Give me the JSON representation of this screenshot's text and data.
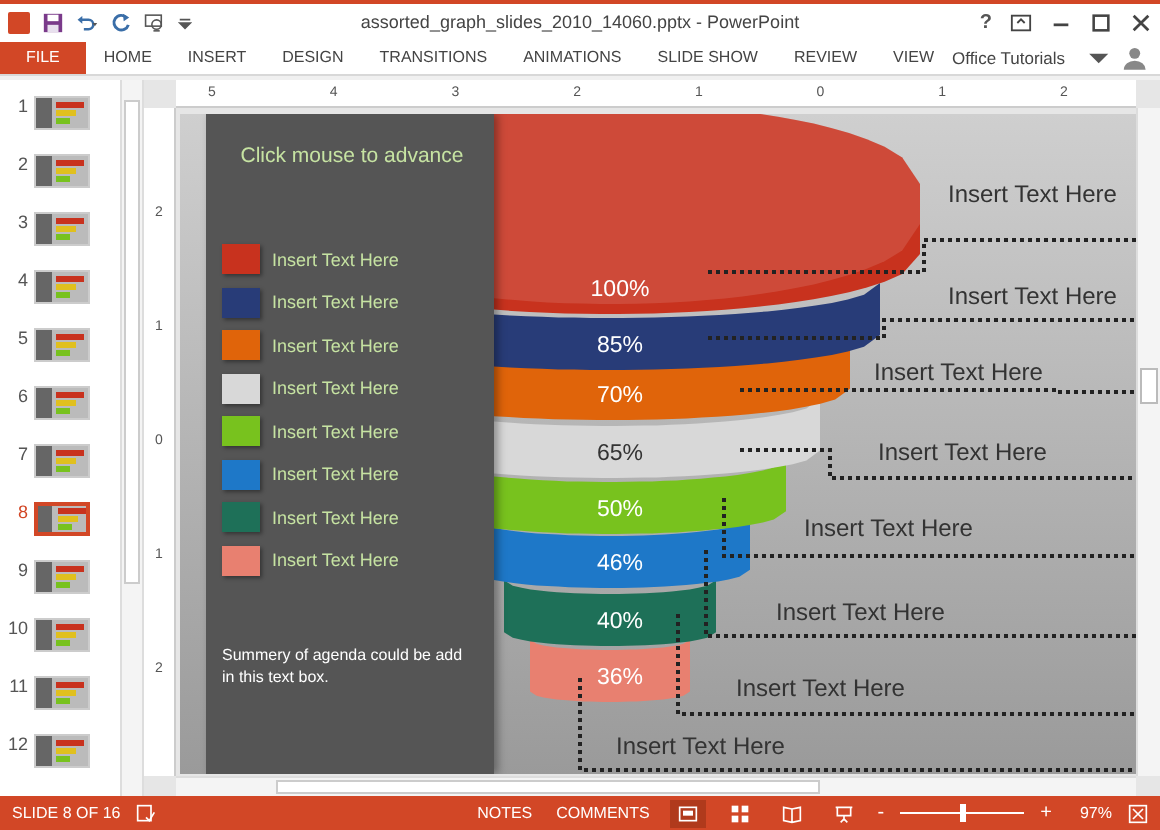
{
  "window": {
    "title": "assorted_graph_slides_2010_14060.pptx - PowerPoint",
    "user": "Office Tutorials",
    "help": "?"
  },
  "ribbon_tabs": [
    {
      "label": "FILE",
      "selected": true
    },
    {
      "label": "HOME",
      "selected": false
    },
    {
      "label": "INSERT",
      "selected": false
    },
    {
      "label": "DESIGN",
      "selected": false
    },
    {
      "label": "TRANSITIONS",
      "selected": false
    },
    {
      "label": "ANIMATIONS",
      "selected": false
    },
    {
      "label": "SLIDE SHOW",
      "selected": false
    },
    {
      "label": "REVIEW",
      "selected": false
    },
    {
      "label": "VIEW",
      "selected": false
    }
  ],
  "thumbnails": [
    {
      "number": "1",
      "selected": false
    },
    {
      "number": "2",
      "selected": false
    },
    {
      "number": "3",
      "selected": false
    },
    {
      "number": "4",
      "selected": false
    },
    {
      "number": "5",
      "selected": false
    },
    {
      "number": "6",
      "selected": false
    },
    {
      "number": "7",
      "selected": false
    },
    {
      "number": "8",
      "selected": true
    },
    {
      "number": "9",
      "selected": false
    },
    {
      "number": "10",
      "selected": false
    },
    {
      "number": "11",
      "selected": false
    },
    {
      "number": "12",
      "selected": false
    }
  ],
  "ruler_horizontal": [
    "5",
    "4",
    "3",
    "2",
    "1",
    "0",
    "1",
    "2"
  ],
  "ruler_vertical": [
    "2",
    "1",
    "0",
    "1",
    "2"
  ],
  "slide": {
    "heading": "Click mouse to advance",
    "legend": [
      {
        "label": "Insert Text Here",
        "color": "#c8321e"
      },
      {
        "label": "Insert Text Here",
        "color": "#283c78"
      },
      {
        "label": "Insert Text Here",
        "color": "#e0640a"
      },
      {
        "label": "Insert Text Here",
        "color": "#d8d8d8"
      },
      {
        "label": "Insert Text Here",
        "color": "#78c21e"
      },
      {
        "label": "Insert Text Here",
        "color": "#1e78c8"
      },
      {
        "label": "Insert Text Here",
        "color": "#1e7058"
      },
      {
        "label": "Insert Text Here",
        "color": "#e88070"
      }
    ],
    "summary": "Summery of agenda could be add in this text box.",
    "funnel": [
      {
        "percent": "100%",
        "color": "#c8321e"
      },
      {
        "percent": "85%",
        "color": "#283c78"
      },
      {
        "percent": "70%",
        "color": "#e0640a"
      },
      {
        "percent": "65%",
        "color": "#d8d8d8"
      },
      {
        "percent": "50%",
        "color": "#78c21e"
      },
      {
        "percent": "46%",
        "color": "#1e78c8"
      },
      {
        "percent": "40%",
        "color": "#1e7058"
      },
      {
        "percent": "36%",
        "color": "#e88070"
      }
    ],
    "callouts": [
      "Insert Text Here",
      "Insert Text Here",
      "Insert Text Here",
      "Insert Text Here",
      "Insert Text Here",
      "Insert Text Here",
      "Insert Text Here",
      "Insert Text Here"
    ]
  },
  "status_bar": {
    "slide_info": "SLIDE 8 OF 16",
    "notes": "NOTES",
    "comments": "COMMENTS",
    "zoom_minus": "-",
    "zoom_plus": "+",
    "zoom": {
      "level": 0.5
    },
    "zoom_percent": "97%"
  }
}
